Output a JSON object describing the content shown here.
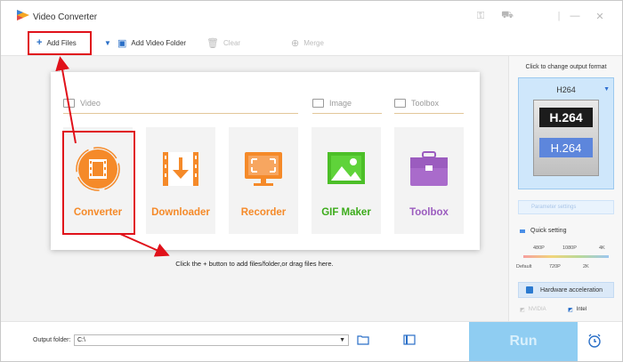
{
  "app": {
    "title": "Video Converter"
  },
  "titlebar": {
    "key_icon": "key-icon",
    "cart_icon": "cart-icon",
    "minimize": "—",
    "close": "✕"
  },
  "toolbar": {
    "add_files": "Add Files",
    "add_video_folder": "Add Video Folder",
    "clear": "Clear",
    "merge": "Merge"
  },
  "sections": {
    "video": "Video",
    "image": "Image",
    "toolbox": "Toolbox"
  },
  "tiles": [
    {
      "label": "Converter",
      "icon": "film-reel-icon"
    },
    {
      "label": "Downloader",
      "icon": "download-icon"
    },
    {
      "label": "Recorder",
      "icon": "monitor-record-icon"
    },
    {
      "label": "GIF Maker",
      "icon": "image-mountain-icon"
    },
    {
      "label": "Toolbox",
      "icon": "toolbox-icon"
    }
  ],
  "hint": "Click the + button to add files/folder,or drag files here.",
  "output_panel": {
    "title": "Click to change output format",
    "format": "H264",
    "badge_top": "H.264",
    "badge_bottom": "H.264",
    "parameter_settings": "Parameter settings",
    "quick_setting": "Quick setting",
    "scale_top": [
      "480P",
      "1080P",
      "4K"
    ],
    "scale_bottom": [
      "Default",
      "720P",
      "2K"
    ],
    "hardware_acceleration": "Hardware acceleration",
    "nvidia": "NVIDIA",
    "intel": "Intel"
  },
  "bottom": {
    "output_folder_label": "Output folder:",
    "output_folder_value": "C:\\",
    "run": "Run"
  },
  "colors": {
    "accent_orange": "#f58a29",
    "purple": "#9b5cbf",
    "green": "#3cab1b",
    "highlight_red": "#e0111a",
    "run_blue": "#8fcdf2"
  }
}
